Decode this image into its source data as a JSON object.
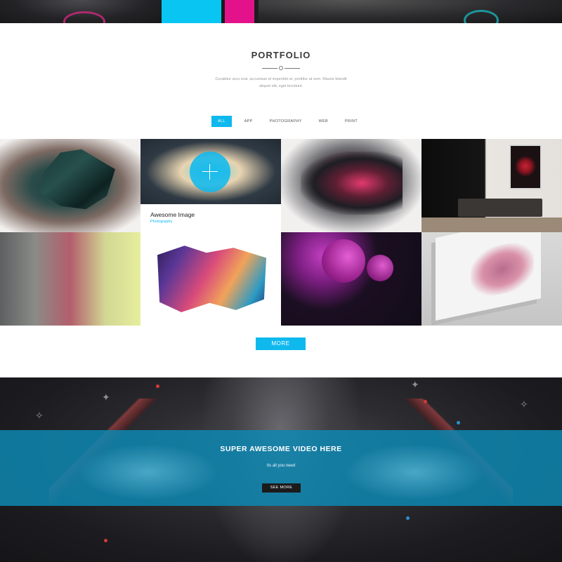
{
  "portfolio": {
    "title": "PORTFOLIO",
    "description": "Curabitur arcu erat, accumsan id imperdiet et, porttitor at sem. Mauris blandit aliquet elit, eget tincidunt."
  },
  "filters": {
    "items": [
      {
        "label": "ALL",
        "active": true
      },
      {
        "label": "APP",
        "active": false
      },
      {
        "label": "PHOTOGRAPHY",
        "active": false
      },
      {
        "label": "WEB",
        "active": false
      },
      {
        "label": "PRINT",
        "active": false
      }
    ]
  },
  "grid": {
    "featured": {
      "title": "Awesome Image",
      "category": "Photography"
    }
  },
  "more_button": {
    "label": "MORE"
  },
  "video": {
    "title": "SUPER AWESOME VIDEO HERE",
    "subtitle": "Its all you need",
    "button": "SEE MORE"
  },
  "colors": {
    "accent": "#0fb9ee",
    "magenta": "#e4128a",
    "dark": "#1b1b1b",
    "video_band": "#0e87b2"
  }
}
